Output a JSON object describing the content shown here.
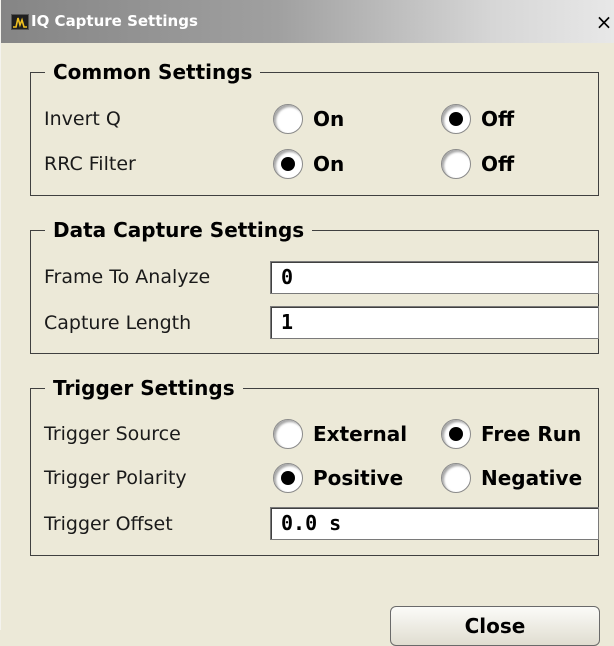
{
  "window": {
    "title": "IQ Capture Settings",
    "close_glyph": "×",
    "icon": "spectrum-analyzer-icon"
  },
  "common": {
    "title": "Common Settings",
    "invert_q": {
      "label": "Invert Q",
      "options": [
        "On",
        "Off"
      ],
      "selected": "Off"
    },
    "rrc_filter": {
      "label": "RRC Filter",
      "options": [
        "On",
        "Off"
      ],
      "selected": "On"
    }
  },
  "data_capture": {
    "title": "Data Capture Settings",
    "frame_to_analyze": {
      "label": "Frame To Analyze",
      "value": "0"
    },
    "capture_length": {
      "label": "Capture Length",
      "value": "1"
    }
  },
  "trigger": {
    "title": "Trigger Settings",
    "source": {
      "label": "Trigger Source",
      "options": [
        "External",
        "Free Run"
      ],
      "selected": "Free Run"
    },
    "polarity": {
      "label": "Trigger Polarity",
      "options": [
        "Positive",
        "Negative"
      ],
      "selected": "Positive"
    },
    "offset": {
      "label": "Trigger Offset",
      "value": "0.0 s"
    }
  },
  "buttons": {
    "close": "Close"
  }
}
